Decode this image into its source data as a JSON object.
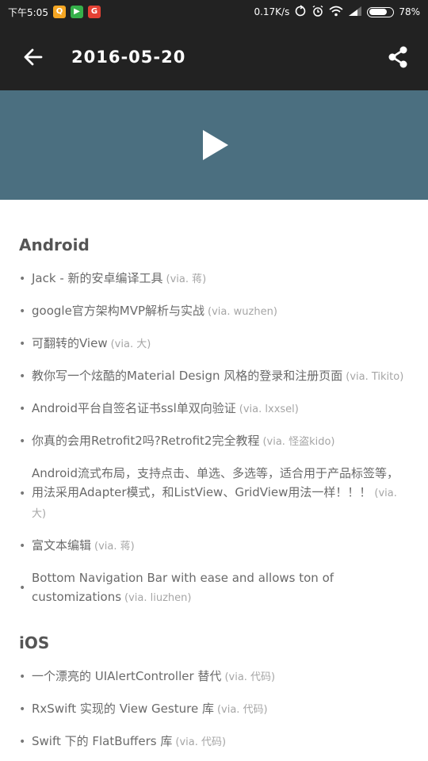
{
  "status_bar": {
    "time": "下午5:05",
    "apps": [
      {
        "icon": "qq-icon",
        "color": "#f5a623"
      },
      {
        "icon": "play-store-icon",
        "color": "#35b04a"
      },
      {
        "icon": "google-icon",
        "color": "#e44134"
      }
    ],
    "network_speed": "0.17K/s",
    "battery": "78%",
    "battery_level": 0.78
  },
  "toolbar": {
    "back_icon": "arrow-left-icon",
    "title": "2016-05-20",
    "share_icon": "share-icon"
  },
  "hero": {
    "background": "#4b6f80",
    "play_icon": "play-icon"
  },
  "sections": [
    {
      "title": "Android",
      "items": [
        {
          "text": "Jack - 新的安卓编译工具",
          "via": "(via. 蒋)"
        },
        {
          "text": "google官方架构MVP解析与实战",
          "via": "(via. wuzhen)"
        },
        {
          "text": "可翻转的View",
          "via": "(via. 大)"
        },
        {
          "text": "教你写一个炫酷的Material Design 风格的登录和注册页面",
          "via": "(via. Tikito)"
        },
        {
          "text": "Android平台自签名证书ssl单双向验证",
          "via": "(via. lxxsel)"
        },
        {
          "text": "你真的会用Retrofit2吗?Retrofit2完全教程",
          "via": "(via. 怪盗kido)"
        },
        {
          "text": "Android流式布局，支持点击、单选、多选等，适合用于产品标签等，用法采用Adapter模式，和ListView、GridView用法一样！！！",
          "via": "(via. 大)"
        },
        {
          "text": "富文本编辑",
          "via": "(via. 蒋)"
        },
        {
          "text": "Bottom Navigation Bar with ease and allows ton of customizations",
          "via": "(via. liuzhen)"
        }
      ]
    },
    {
      "title": "iOS",
      "items": [
        {
          "text": "一个漂亮的 UIAlertController 替代",
          "via": "(via. 代码)"
        },
        {
          "text": "RxSwift 实现的 View Gesture 库",
          "via": "(via. 代码)"
        },
        {
          "text": "Swift 下的 FlatBuffers 库",
          "via": "(via. 代码)"
        }
      ]
    }
  ]
}
